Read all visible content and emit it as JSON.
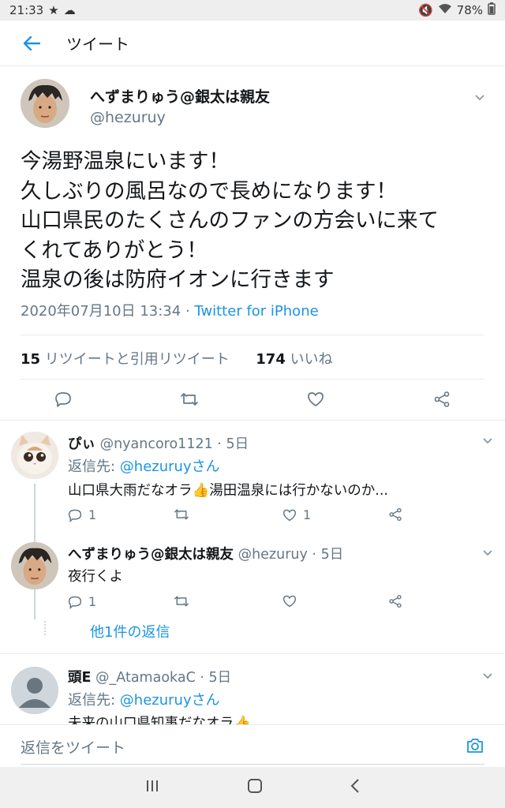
{
  "status_bar": {
    "time": "21:33",
    "battery": "78%"
  },
  "header": {
    "title": "ツイート"
  },
  "tweet": {
    "name": "へずまりゅう@銀太は親友",
    "handle": "@hezuruy",
    "lines": [
      "今湯野温泉にいます！",
      "久しぶりの風呂なので長めになります！",
      "山口県民のたくさんのファンの方会いに来て",
      "くれてありがとう！",
      "温泉の後は防府イオンに行きます"
    ],
    "timestamp": "2020年07月10日 13:34",
    "separator": " · ",
    "source": "Twitter for iPhone",
    "retweets": "15",
    "retweets_label": "リツイートと引用リツイート",
    "likes": "174",
    "likes_label": "いいね"
  },
  "replies": [
    {
      "name": "ぴぃ",
      "handle": "@nyancoro1121",
      "time": "5日",
      "reply_to_label": "返信先: ",
      "reply_to": "@hezuruyさん",
      "text": "山口県大雨だなオラ👍湯田温泉には行かないのか...",
      "reply_count": "1",
      "like_count": "1"
    },
    {
      "name": "へずまりゅう@銀太は親友",
      "handle": "@hezuruy",
      "time": "5日",
      "text": "夜行くよ",
      "reply_count": "1",
      "more_replies": "他1件の返信"
    },
    {
      "name": "頭E",
      "handle": "@_AtamaokaC",
      "time": "5日",
      "reply_to_label": "返信先: ",
      "reply_to": "@hezuruyさん",
      "text": "未来の山口県知事だなオラ👍"
    }
  ],
  "composer": {
    "placeholder": "返信をツイート"
  },
  "colors": {
    "accent": "#1b95e0",
    "secondary_text": "#657786",
    "divider": "#e6ecf0"
  },
  "icons": [
    "back-arrow-icon",
    "chevron-down-icon",
    "reply-icon",
    "retweet-icon",
    "like-icon",
    "share-icon",
    "camera-icon",
    "recents-icon",
    "home-icon",
    "back-nav-icon"
  ]
}
